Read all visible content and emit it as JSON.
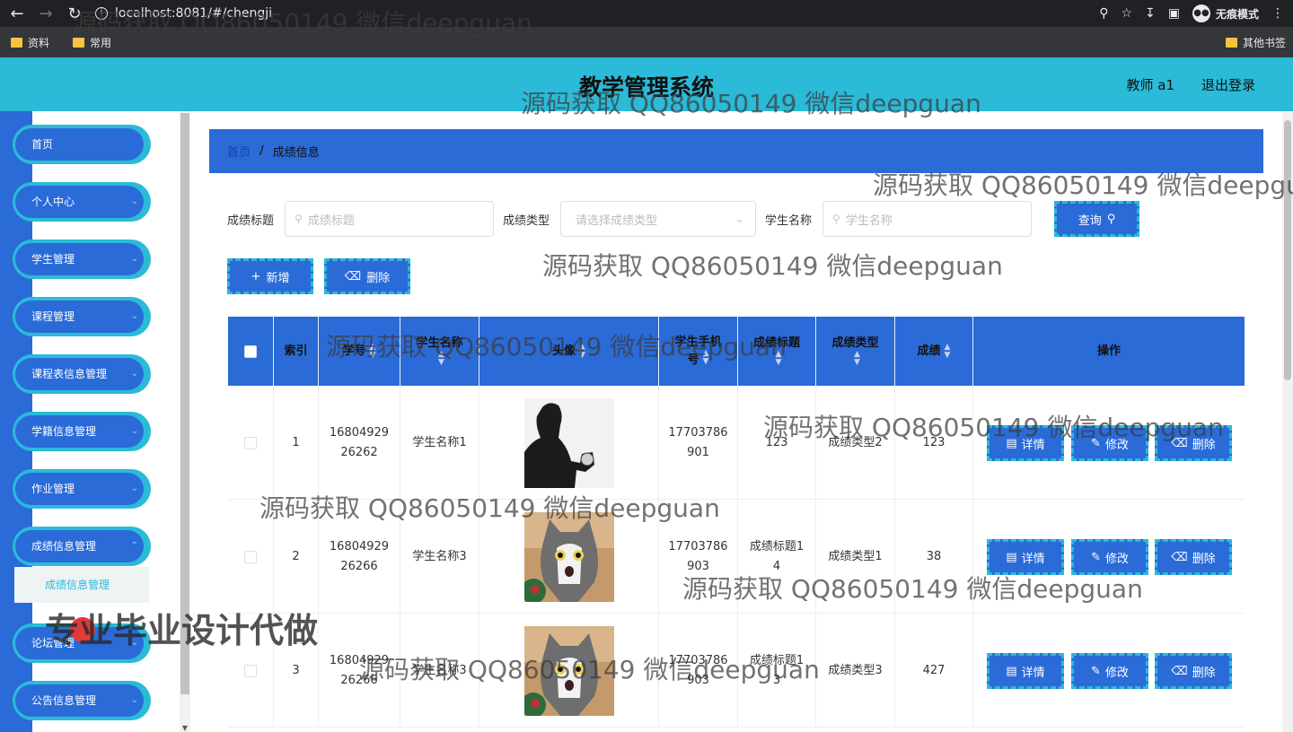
{
  "browser": {
    "url": "localhost:8081/#/chengji",
    "incognito_label": "无痕模式",
    "bookmarks": [
      "资料",
      "常用"
    ],
    "other_bookmarks": "其他书签"
  },
  "header": {
    "title": "教学管理系统",
    "user": "教师 a1",
    "logout": "退出登录"
  },
  "sidebar": {
    "items": [
      {
        "label": "首页"
      },
      {
        "label": "个人中心"
      },
      {
        "label": "学生管理"
      },
      {
        "label": "课程管理"
      },
      {
        "label": "课程表信息管理"
      },
      {
        "label": "学籍信息管理"
      },
      {
        "label": "作业管理"
      },
      {
        "label": "成绩信息管理"
      },
      {
        "label": "论坛管理"
      },
      {
        "label": "公告信息管理"
      }
    ],
    "active_sub": "成绩信息管理"
  },
  "breadcrumb": {
    "home": "首页",
    "sep": "/",
    "current": "成绩信息"
  },
  "search": {
    "title_label": "成绩标题",
    "title_placeholder": "成绩标题",
    "type_label": "成绩类型",
    "type_placeholder": "请选择成绩类型",
    "name_label": "学生名称",
    "name_placeholder": "学生名称",
    "query_btn": "查询"
  },
  "toolbar": {
    "add": "新增",
    "delete": "删除"
  },
  "table": {
    "headers": {
      "index": "索引",
      "xuehao": "学号",
      "name": "学生名称",
      "avatar": "头像",
      "phone_1": "学生手机",
      "phone_2": "号",
      "score_title": "成绩标题",
      "score_type": "成绩类型",
      "score": "成绩",
      "actions": "操作"
    },
    "rows": [
      {
        "index": "1",
        "xuehao_1": "16804929",
        "xuehao_2": "26262",
        "name": "学生名称1",
        "avatar": "person-photo",
        "phone_1": "17703786",
        "phone_2": "901",
        "title_1": "123",
        "title_2": "",
        "type": "成绩类型2",
        "score": "123"
      },
      {
        "index": "2",
        "xuehao_1": "16804929",
        "xuehao_2": "26266",
        "name": "学生名称3",
        "avatar": "cat-photo",
        "phone_1": "17703786",
        "phone_2": "903",
        "title_1": "成绩标题1",
        "title_2": "4",
        "type": "成绩类型1",
        "score": "38"
      },
      {
        "index": "3",
        "xuehao_1": "16804929",
        "xuehao_2": "26266",
        "name": "学生名称3",
        "avatar": "cat-photo",
        "phone_1": "17703786",
        "phone_2": "903",
        "title_1": "成绩标题1",
        "title_2": "3",
        "type": "成绩类型3",
        "score": "427"
      }
    ],
    "actions": {
      "detail": "详情",
      "edit": "修改",
      "delete": "删除"
    }
  },
  "overlays": {
    "watermark": "源码获取 QQ86050149 微信deepguan",
    "promo": "专业毕业设计代做"
  },
  "colors": {
    "header": "#2bbad8",
    "primary": "#2a6bd8"
  }
}
